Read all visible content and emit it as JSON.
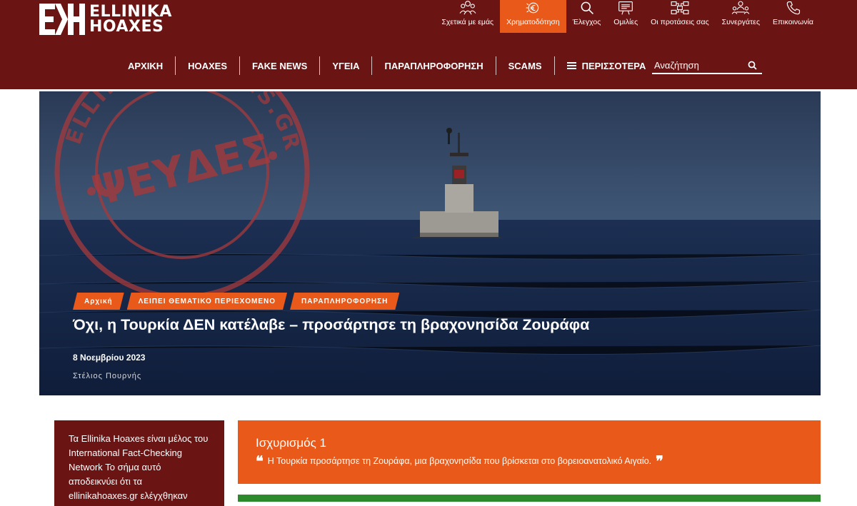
{
  "brand": {
    "logo_line1": "ELLINIKA",
    "logo_line2": "HOAXES"
  },
  "topnav": [
    {
      "label": "Σχετικά με εμάς",
      "icon": "team-icon"
    },
    {
      "label": "Χρηματοδότηση",
      "icon": "funding-icon",
      "active": true
    },
    {
      "label": "Έλεγχος",
      "icon": "search-icon"
    },
    {
      "label": "Ομιλίες",
      "icon": "presentation-icon"
    },
    {
      "label": "Οι προτάσεις σας",
      "icon": "suggestions-icon"
    },
    {
      "label": "Συνεργάτες",
      "icon": "partners-icon"
    },
    {
      "label": "Επικοινωνία",
      "icon": "phone-icon"
    }
  ],
  "mainnav": [
    {
      "label": "ΑΡΧΙΚΗ"
    },
    {
      "label": "HOAXES"
    },
    {
      "label": "FAKE NEWS"
    },
    {
      "label": "ΥΓΕΙΑ"
    },
    {
      "label": "ΠΑΡΑΠΛΗΡΟΦΟΡΗΣΗ"
    },
    {
      "label": "SCAMS"
    },
    {
      "label": "ΠΕΡΙΣΣΟΤΕΡΑ"
    }
  ],
  "search": {
    "placeholder": "Αναζήτηση"
  },
  "hero": {
    "stamp_word": "ΨΕΥΔΕΣ",
    "stamp_ring": "ELLINIKAHOAXES.GR",
    "tags": [
      "Αρχική",
      "ΛΕΙΠΕΙ ΘΕΜΑΤΙΚΟ ΠΕΡΙΕΧΟΜΕΝΟ",
      "ΠΑΡΑΠΛΗΡΟΦΟΡΗΣΗ"
    ],
    "title": "Όχι, η Τουρκία ΔΕΝ κατέλαβε – προσάρτησε τη βραχονησίδα Ζουράφα",
    "date": "8 Νοεμβρίου 2023",
    "author": "Στέλιος Πουρνής"
  },
  "sidebar": {
    "ifcn_text": "Τα Ellinika Hoaxes είναι μέλος του International Fact-Checking Network Το σήμα αυτό αποδεικνύει ότι τα ellinikahoaxes.gr ελέγχθηκαν"
  },
  "claim": {
    "title": "Ισχυρισμός 1",
    "text": "Η Τουρκία προσάρτησε τη Ζουράφα, μια βραχονησίδα που βρίσκεται στο βορειοανατολικό Αιγαίο."
  },
  "colors": {
    "header": "#6b1414",
    "accent": "#e8591a",
    "green": "#2c8a2c"
  }
}
